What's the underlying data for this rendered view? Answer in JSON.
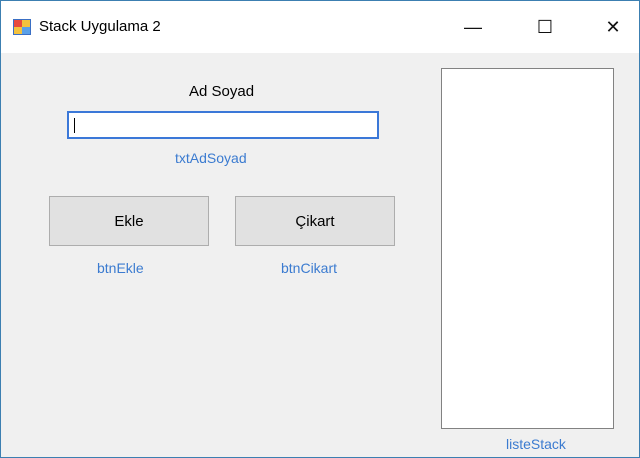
{
  "window": {
    "title": "Stack Uygulama 2",
    "minimize_glyph": "—",
    "maximize_glyph": "☐",
    "close_glyph": "✕"
  },
  "form": {
    "ad_soyad_label": "Ad Soyad",
    "txt_value": "",
    "txt_name": "txtAdSoyad",
    "btn_ekle_label": "Ekle",
    "btn_ekle_name": "btnEkle",
    "btn_cikart_label": "Çikart",
    "btn_cikart_name": "btnCikart",
    "listbox_name": "listeStack"
  },
  "colors": {
    "accent": "#3b78d8",
    "designer_label": "#3b7bd0"
  }
}
